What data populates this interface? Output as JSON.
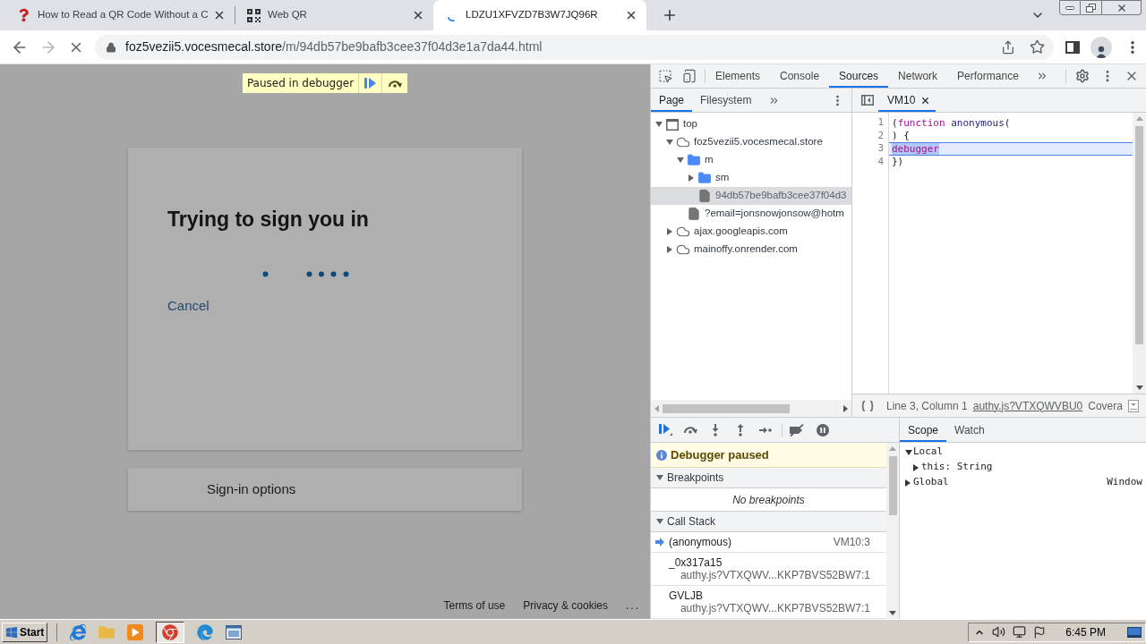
{
  "browser": {
    "tabs": [
      {
        "title": "How to Read a QR Code Without a C",
        "kind": "question",
        "selected": false
      },
      {
        "title": "Web QR",
        "kind": "qr",
        "selected": false
      },
      {
        "title": "LDZU1XFVZD7B3W7JQ96R",
        "kind": "loading",
        "selected": true
      }
    ],
    "nav_buttons": [
      {
        "kind": "back",
        "disabled": false
      },
      {
        "kind": "forward",
        "disabled": true
      },
      {
        "kind": "stop",
        "disabled": false
      }
    ],
    "address": {
      "host": "foz5vezii5.vocesmecal.store",
      "path": "/m/94db57be9bafb3cee37f04d3e1a7da44.html"
    }
  },
  "page": {
    "paused_banner": {
      "label": "Paused in debugger"
    },
    "card": {
      "title": "Trying to sign you in",
      "link": "Cancel"
    },
    "options": {
      "label": "Sign-in options"
    },
    "footer": [
      "Terms of use",
      "Privacy & cookies",
      "..."
    ]
  },
  "devtools": {
    "tabs": [
      {
        "label": "Elements",
        "selected": false
      },
      {
        "label": "Console",
        "selected": false
      },
      {
        "label": "Sources",
        "selected": true
      },
      {
        "label": "Network",
        "selected": false
      },
      {
        "label": "Performance",
        "selected": false
      }
    ],
    "navigator_tabs": [
      {
        "label": "Page",
        "selected": true
      },
      {
        "label": "Filesystem",
        "selected": false
      }
    ],
    "editor_tabs": [
      {
        "label": "VM10",
        "selected": true
      }
    ],
    "tree": [
      {
        "label": "top",
        "kind": "frame",
        "expanded": true,
        "selected": false,
        "children": [
          {
            "label": "foz5vezii5.vocesmecal.store",
            "kind": "domain",
            "expanded": true,
            "selected": false,
            "children": [
              {
                "label": "m",
                "kind": "folder",
                "expanded": true,
                "selected": false,
                "children": [
                  {
                    "label": "sm",
                    "kind": "folder",
                    "expanded": false,
                    "selected": false
                  },
                  {
                    "label": "94db57be9bafb3cee37f04d3",
                    "kind": "file",
                    "selected": true
                  }
                ]
              },
              {
                "label": "?email=jonsnowjonsow@hotm",
                "kind": "file",
                "selected": false
              }
            ]
          },
          {
            "label": "ajax.googleapis.com",
            "kind": "domain",
            "expanded": false,
            "selected": false
          },
          {
            "label": "mainoffy.onrender.com",
            "kind": "domain",
            "expanded": false,
            "selected": false
          }
        ]
      }
    ],
    "editor": {
      "lines": [
        {
          "number": "1",
          "current": false,
          "tokens": [
            {
              "text": "(",
              "kind": "plain",
              "marked": false
            },
            {
              "text": "function ",
              "kind": "keyword",
              "marked": false
            },
            {
              "text": "anonymous",
              "kind": "name",
              "marked": false
            },
            {
              "text": "(",
              "kind": "plain",
              "marked": false
            }
          ]
        },
        {
          "number": "2",
          "current": false,
          "tokens": [
            {
              "text": ") {",
              "kind": "plain",
              "marked": false
            }
          ]
        },
        {
          "number": "3",
          "current": true,
          "tokens": [
            {
              "text": "debugger",
              "kind": "keyword",
              "marked": true
            }
          ]
        },
        {
          "number": "4",
          "current": false,
          "tokens": [
            {
              "text": "})",
              "kind": "plain",
              "marked": false
            }
          ]
        }
      ]
    },
    "status": {
      "position": "Line 3, Column 1",
      "source_link": "authy.js?VTXQWVBU0",
      "coverage": "Covera"
    },
    "paused_message": "Debugger paused",
    "breakpoints": {
      "title": "Breakpoints",
      "expanded": true,
      "empty_text": "No breakpoints"
    },
    "call_stack": {
      "title": "Call Stack",
      "expanded": true,
      "frames": [
        {
          "name": "(anonymous)",
          "location": "VM10:3",
          "current": true
        },
        {
          "name": "_0x317a15",
          "location": "authy.js?VTXQWV...KKP7BVS52BW7:1",
          "current": false
        },
        {
          "name": "GVLJB",
          "location": "authy.js?VTXQWV...KKP7BVS52BW7:1",
          "current": false
        }
      ]
    },
    "side_tabs": [
      {
        "label": "Scope",
        "selected": true
      },
      {
        "label": "Watch",
        "selected": false
      }
    ],
    "scope": [
      {
        "label": "Local",
        "expanded": true,
        "children": [
          {
            "label": "this: String",
            "expanded": false
          }
        ]
      },
      {
        "label": "Global",
        "value": "Window",
        "expanded": false
      }
    ]
  },
  "taskbar": {
    "start": "Start",
    "apps": [
      {
        "kind": "ie",
        "active": false
      },
      {
        "kind": "folder",
        "active": false
      },
      {
        "kind": "media",
        "active": false
      },
      {
        "kind": "chrome",
        "active": true
      },
      {
        "kind": "edge",
        "active": false
      },
      {
        "kind": "window",
        "active": false
      }
    ],
    "clock": "6:45 PM"
  }
}
